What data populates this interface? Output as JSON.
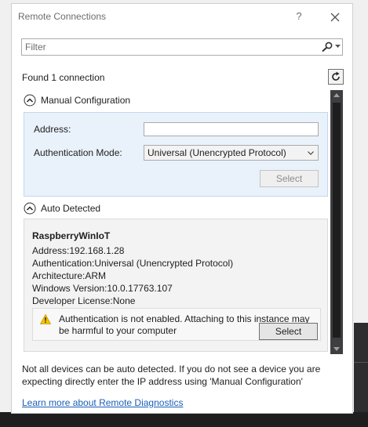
{
  "window": {
    "title": "Remote Connections",
    "help_label": "?"
  },
  "filter": {
    "placeholder": "Filter"
  },
  "status": {
    "found_text": "Found 1 connection"
  },
  "manual": {
    "header": "Manual Configuration",
    "address_label": "Address:",
    "address_value": "",
    "auth_label": "Authentication Mode:",
    "auth_value": "Universal (Unencrypted Protocol)",
    "select_label": "Select"
  },
  "auto": {
    "header": "Auto Detected",
    "device": {
      "name": "RaspberryWinIoT",
      "lines": [
        "Address:192.168.1.28",
        "Authentication:Universal (Unencrypted Protocol)",
        "Architecture:ARM",
        "Windows Version:10.0.17763.107",
        "Developer License:None"
      ],
      "warning": "Authentication is not enabled. Attaching to this instance may be harmful to your computer",
      "select_label": "Select"
    }
  },
  "footer": {
    "note": "Not all devices can be auto detected. If you do not see a device you are expecting directly enter the IP address using 'Manual Configuration'",
    "link": "Learn more about Remote Diagnostics"
  },
  "icons": {
    "search": "search-icon",
    "refresh": "refresh-icon",
    "close": "close-icon",
    "collapse": "collapse-icon",
    "warning": "warning-icon"
  },
  "colors": {
    "link": "#1b5eb8",
    "panel_blue": "#e9f1fa",
    "warning_yellow": "#f5c400"
  }
}
